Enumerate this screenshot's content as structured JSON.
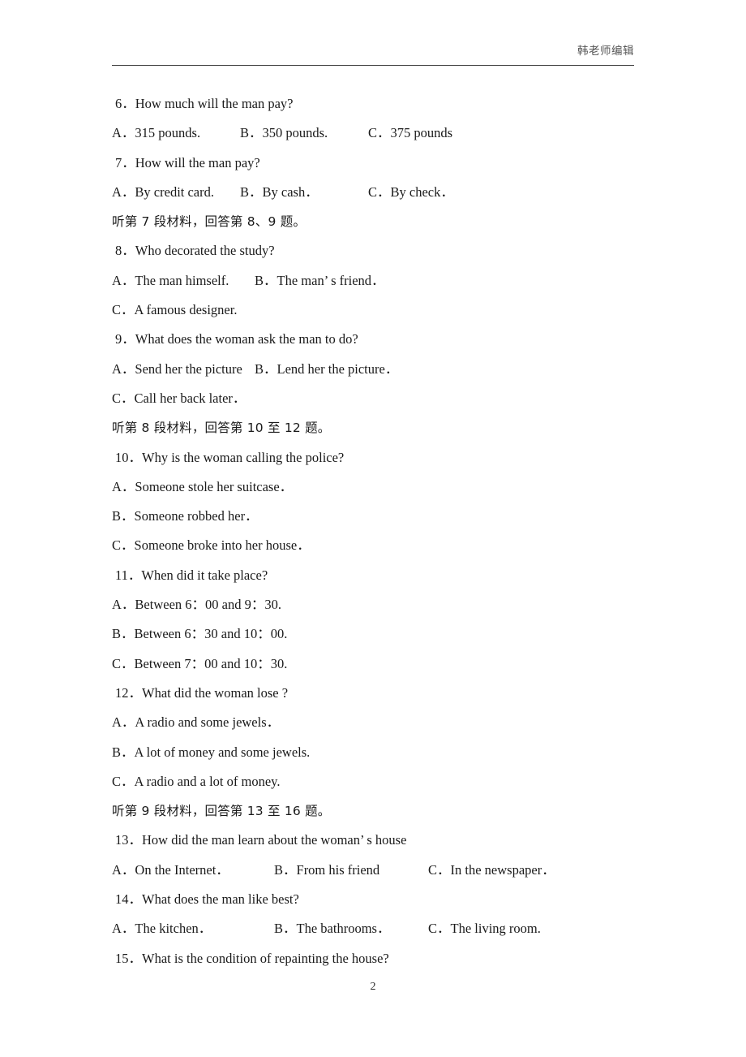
{
  "header": {
    "editor_note": "韩老师编辑"
  },
  "footer": {
    "page_number": "2"
  },
  "colors": {
    "text": "#1a1a1a",
    "header_text": "#555555",
    "rule": "#3f3f3f",
    "background": "#ffffff"
  },
  "content": {
    "blocks": [
      {
        "id": "q6",
        "stem": "6．How much will the man pay?",
        "options": [
          {
            "label": "A．",
            "text": "315 pounds."
          },
          {
            "label": "B．",
            "text": "350 pounds."
          },
          {
            "label": "C．",
            "text": "375 pounds"
          }
        ]
      },
      {
        "id": "q7",
        "stem": "7．How will the man pay?",
        "options": [
          {
            "label": "A．",
            "text": "By credit card."
          },
          {
            "label": "B．",
            "text": "By cash．"
          },
          {
            "label": "C．",
            "text": "By check．"
          }
        ]
      },
      {
        "id": "instruction-7",
        "text": "听第 7 段材料，回答第 8、9 题。"
      },
      {
        "id": "q8",
        "stem": "8．Who decorated the study?",
        "options": [
          {
            "label": "A．",
            "text": "The man himself."
          },
          {
            "label": "B．",
            "text": "The man’ s friend．"
          },
          {
            "label": "C．",
            "text": "A famous designer."
          }
        ]
      },
      {
        "id": "q9",
        "stem": "9．What does the woman ask the man to do?",
        "options": [
          {
            "label": "A．",
            "text": "Send her the picture"
          },
          {
            "label": "B．",
            "text": "Lend her the picture．"
          },
          {
            "label": "C．",
            "text": "Call her back later．"
          }
        ]
      },
      {
        "id": "instruction-8",
        "text": "听第 8 段材料，回答第 10 至 12 题。"
      },
      {
        "id": "q10",
        "stem": "10．Why is the woman calling the police?",
        "options": [
          {
            "label": "A．",
            "text": "Someone stole her suitcase．"
          },
          {
            "label": "B．",
            "text": "Someone robbed her．"
          },
          {
            "label": "C．",
            "text": "Someone broke into her house．"
          }
        ]
      },
      {
        "id": "q11",
        "stem": "11．When did it take place?",
        "options": [
          {
            "label": "A．",
            "text": "Between 6：00 and 9：30."
          },
          {
            "label": "B．",
            "text": "Between 6：30 and 10：00."
          },
          {
            "label": "C．",
            "text": "Between 7：00 and 10：30."
          }
        ]
      },
      {
        "id": "q12",
        "stem": "12．What did the woman lose ?",
        "options": [
          {
            "label": "A．",
            "text": "A radio and some jewels．"
          },
          {
            "label": "B．",
            "text": "A lot of money and some jewels."
          },
          {
            "label": "C．",
            "text": "A radio and a lot of money."
          }
        ]
      },
      {
        "id": "instruction-9",
        "text": "听第 9 段材料，回答第 13 至 16 题。"
      },
      {
        "id": "q13",
        "stem": "13．How did the man learn about the woman’ s house",
        "options": [
          {
            "label": "A．",
            "text": "On the Internet．"
          },
          {
            "label": "B．",
            "text": "From his friend"
          },
          {
            "label": "C．",
            "text": "In the newspaper．"
          }
        ]
      },
      {
        "id": "q14",
        "stem": "14．What does the man like best?",
        "options": [
          {
            "label": "A．",
            "text": "The kitchen．"
          },
          {
            "label": "B．",
            "text": "The bathrooms．"
          },
          {
            "label": "C．",
            "text": "The living room."
          }
        ]
      },
      {
        "id": "q15",
        "stem": "15．What is the condition of repainting the house?",
        "options": []
      }
    ]
  }
}
